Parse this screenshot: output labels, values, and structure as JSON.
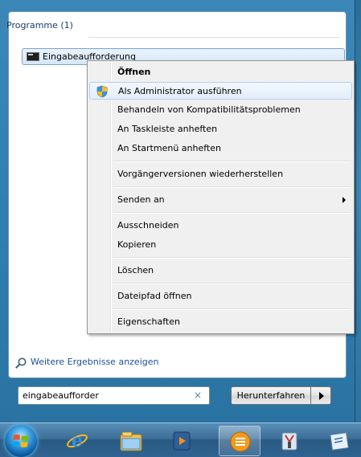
{
  "results": {
    "group_header": "Programme (1)",
    "items": [
      {
        "label": "Eingabeaufforderung"
      }
    ]
  },
  "context_menu": {
    "items": [
      {
        "label": "Öffnen"
      },
      {
        "label": "Als Administrator ausführen"
      },
      {
        "label": "Behandeln von Kompatibilitätsproblemen"
      },
      {
        "label": "An Taskleiste anheften"
      },
      {
        "label": "An Startmenü anheften"
      },
      {
        "label": "Vorgängerversionen wiederherstellen"
      },
      {
        "label": "Senden an"
      },
      {
        "label": "Ausschneiden"
      },
      {
        "label": "Kopieren"
      },
      {
        "label": "Löschen"
      },
      {
        "label": "Dateipfad öffnen"
      },
      {
        "label": "Eigenschaften"
      }
    ]
  },
  "more_results": {
    "label": "Weitere Ergebnisse anzeigen"
  },
  "search": {
    "value": "eingabeaufforder",
    "clear_glyph": "×"
  },
  "shutdown": {
    "label": "Herunterfahren"
  },
  "taskbar": {
    "items": [
      {
        "icon": "internet-explorer-icon"
      },
      {
        "icon": "windows-explorer-icon"
      },
      {
        "icon": "media-player-icon"
      },
      {
        "icon": "menu-app-icon"
      },
      {
        "icon": "tools-app-icon"
      },
      {
        "icon": "document-app-icon"
      }
    ]
  },
  "colors": {
    "link": "#1a4f9c",
    "highlight_border": "#aecff7",
    "taskbar": "#2f6391"
  }
}
